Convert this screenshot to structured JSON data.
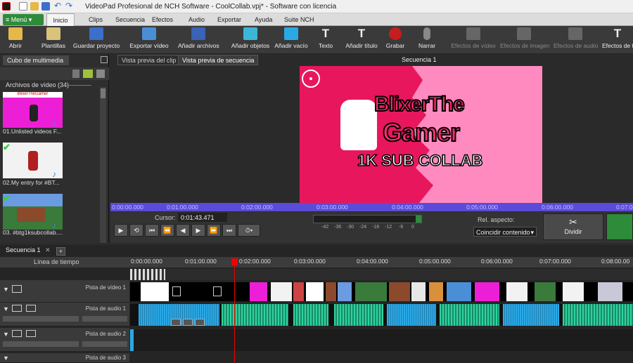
{
  "window": {
    "title": "VideoPad Profesional de NCH Software - CoolCollab.vpj* - Software con licencia"
  },
  "menubar": {
    "menu_label": "≡ Menú ▾",
    "tabs": [
      "Inicio",
      "Clips",
      "Secuencia",
      "Efectos",
      "Audio",
      "Exportar",
      "Ayuda",
      "Suite NCH"
    ]
  },
  "toolbar": {
    "abrir": "Abrir",
    "plantillas": "Plantillas",
    "guardar": "Guardar proyecto",
    "exportar": "Exportar vídeo",
    "anadir_archivos": "Añadir archivos",
    "anadir_objetos": "Añadir objetos",
    "anadir_vacio": "Añadir vacío",
    "texto": "Texto",
    "anadir_titulo": "Añadir título",
    "grabar": "Grabar",
    "narrar": "Narrar",
    "efectos_video": "Efectos de vídeo",
    "efectos_imagen": "Efectos de imagen",
    "efectos_audio": "Efectos de audio",
    "efectos_t": "Efectos de t"
  },
  "media": {
    "tab": "Cubo de multimedia",
    "heading": "Archivos de vídeo (34)",
    "items": [
      "01.Unlisted videos F...",
      "02.My entry for #BT...",
      "03. #btg1ksubcollab...."
    ],
    "thumb_texts": [
      "BlixerTheGamer"
    ]
  },
  "preview": {
    "tab_clip": "Vista previa del clip",
    "tab_seq": "Vista previa de secuencia",
    "sequence_name": "Secuencia 1",
    "frame_title_1": "BlixerThe",
    "frame_title_2": "Gamer",
    "frame_subtitle": "1K SUB COLLAB",
    "ruler": [
      "0:00:00.000",
      "0:01:00.000",
      "0:02:00.000",
      "0:03:00.000",
      "0:04:00.000",
      "0:05:00.000",
      "0:06:00.000",
      "0:07:0"
    ],
    "cursor_label": "Cursor:",
    "cursor_value": "0:01:43.471",
    "meter_ticks": [
      "-42",
      "-36",
      "-30",
      "-24",
      "-18",
      "-12",
      "-6",
      "0"
    ],
    "aspect_label": "Rel. aspecto:",
    "aspect_value": "Coincidir contenido",
    "split_label": "Dividir"
  },
  "timeline": {
    "seq_tab": "Secuencia 1",
    "header_label": "Línea de tiempo",
    "ruler": [
      "0:00:00.000",
      "0:01:00.000",
      "0:02:00.000",
      "0:03:00.000",
      "0:04:00.000",
      "0:05:00.000",
      "0:06:00.000",
      "0:07:00.000",
      "0:08:00.00"
    ],
    "tracks": [
      "Pista de vídeo 1",
      "Pista de audio 1",
      "Pista de audio 2",
      "Pista de audio 3"
    ]
  },
  "colors": {
    "accent_green": "#2e8b3a",
    "frame_pink": "#e8175d",
    "ruler_blue": "#5a4bd8",
    "clip_teal": "#2ed3a0",
    "clip_blue": "#2aa9e6",
    "playhead": "#ff0000"
  }
}
